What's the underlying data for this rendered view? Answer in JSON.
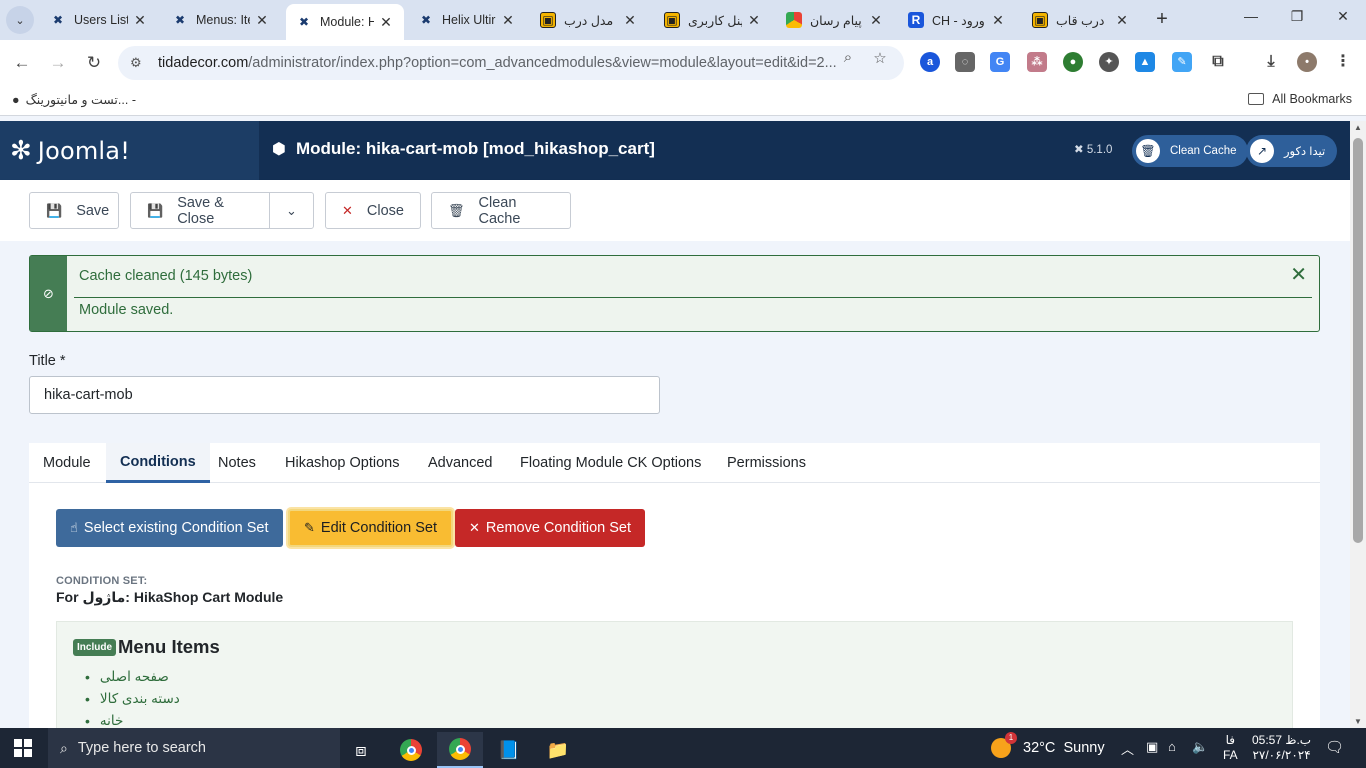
{
  "browser": {
    "tabs": [
      {
        "label": "Users List",
        "icon": "joomla-icon"
      },
      {
        "label": "Menus: Ite",
        "icon": "joomla-icon"
      },
      {
        "label": "Module: H",
        "icon": "joomla-icon",
        "active": true
      },
      {
        "label": "Helix Ultir",
        "icon": "joomla-icon"
      },
      {
        "label": "مدل درب",
        "icon": "site-icon"
      },
      {
        "label": "پنل کاربری",
        "icon": "site-icon"
      },
      {
        "label": "پیام رسان",
        "icon": "chrome-icon"
      },
      {
        "label": "CH - ورود",
        "icon": "r-icon"
      },
      {
        "label": "درب قاب",
        "icon": "site-icon"
      }
    ],
    "url_host": "tidadecor.com",
    "url_path": "/administrator/index.php?option=com_advancedmodules&view=module&layout=edit&id=2...",
    "bookmark_item": "تست و مانیتورینگ... -",
    "bookmarks_all": "All Bookmarks"
  },
  "joomla": {
    "logo_text": "Joomla!",
    "page_title": "Module: hika-cart-mob [mod_hikashop_cart]",
    "version": "5.1.0",
    "clean_cache_pill": "Clean Cache",
    "site_pill": "تیدا دکور"
  },
  "toolbar": {
    "save": "Save",
    "save_close": "Save & Close",
    "close": "Close",
    "clean_cache": "Clean Cache"
  },
  "alert": {
    "message1": "Cache cleaned (145 bytes)",
    "message2": "Module saved."
  },
  "form": {
    "title_label": "Title *",
    "title_value": "hika-cart-mob"
  },
  "tabs": [
    "Module",
    "Conditions",
    "Notes",
    "Hikashop Options",
    "Advanced",
    "Floating Module CK Options",
    "Permissions"
  ],
  "active_tab": "Conditions",
  "conditions": {
    "select_btn": "Select existing Condition Set",
    "edit_btn": "Edit Condition Set",
    "remove_btn": "Remove Condition Set",
    "set_label": "CONDITION SET:",
    "set_name": "For ماژول: HikaShop Cart Module",
    "include_badge": "Include",
    "heading": "Menu Items",
    "items": [
      "صفحه اصلی",
      "دسته بندی کالا",
      "خانه"
    ]
  },
  "taskbar": {
    "search_placeholder": "Type here to search",
    "weather_temp": "32°C",
    "weather_desc": "Sunny",
    "weather_badge": "1",
    "lang": "فا",
    "lang2": "FA",
    "time": "05:57 ب.ظ",
    "date": "۲۷/۰۶/۲۰۲۴"
  },
  "colors": {
    "joomla_header": "#132f53",
    "success": "#457d54",
    "primary_blue": "#3e6a9b",
    "warning": "#f9bc32",
    "danger": "#c52827"
  }
}
